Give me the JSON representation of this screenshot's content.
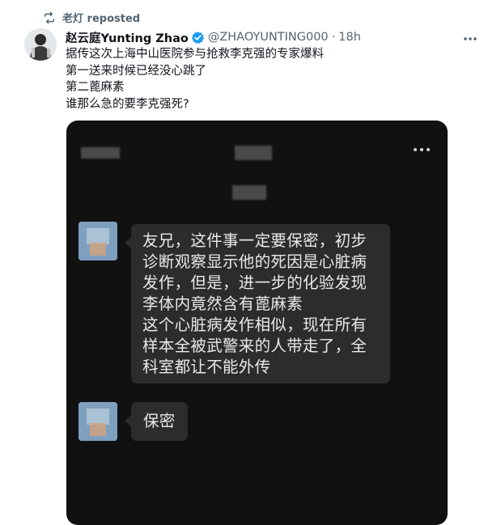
{
  "repost": {
    "reposter": "老灯",
    "label": "reposted",
    "icon": "repost-icon"
  },
  "tweet": {
    "author_name": "赵云庭Yunting Zhao",
    "handle": "@ZHAOYUNTING000",
    "separator": "·",
    "time": "18h",
    "verified_color": "#1d9bf0",
    "lines": [
      "据传这次上海中山医院参与抢救李克强的专家爆料",
      "第一送来时候已经没心跳了",
      "第二蓖麻素",
      "谁那么急的要李克强死?"
    ]
  },
  "media": {
    "type": "chat-screenshot",
    "messages": [
      {
        "lines": [
          "友兄，这件事一定要保密，初步",
          "诊断观察显示他的死因是心脏病",
          "发作，但是，进一步的化验发现",
          "李体内竟然含有蓖麻素",
          "这个心脏病发作相似，现在所有",
          "样本全被武警来的人带走了，全",
          "科室都让不能外传"
        ]
      },
      {
        "text": "保密"
      }
    ]
  }
}
